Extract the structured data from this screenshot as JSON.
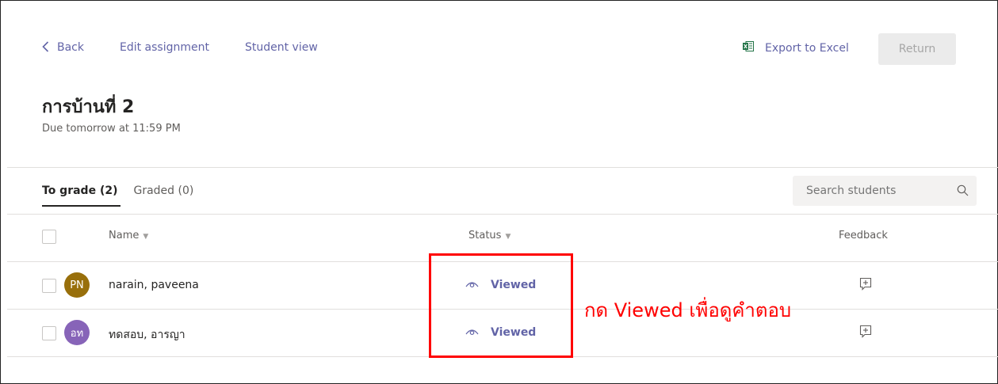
{
  "nav": {
    "back": "Back",
    "edit_assignment": "Edit assignment",
    "student_view": "Student view",
    "export_to_excel": "Export to Excel",
    "return": "Return"
  },
  "assignment": {
    "title": "การบ้านที่ 2",
    "due": "Due tomorrow at 11:59 PM"
  },
  "tabs": {
    "to_grade": "To grade (2)",
    "graded": "Graded (0)"
  },
  "search": {
    "placeholder": "Search students"
  },
  "columns": {
    "name": "Name",
    "status": "Status",
    "feedback": "Feedback"
  },
  "students": [
    {
      "initials": "PN",
      "name": "narain, paveena",
      "status": "Viewed",
      "avatar_color": "#986f0b"
    },
    {
      "initials": "อท",
      "name": "ทดสอบ, อารญา",
      "status": "Viewed",
      "avatar_color": "#8764b8"
    }
  ],
  "annotation": {
    "text": "กด Viewed เพื่อดูคำตอบ",
    "color": "#ff0000"
  },
  "colors": {
    "accent": "#6264a7"
  }
}
